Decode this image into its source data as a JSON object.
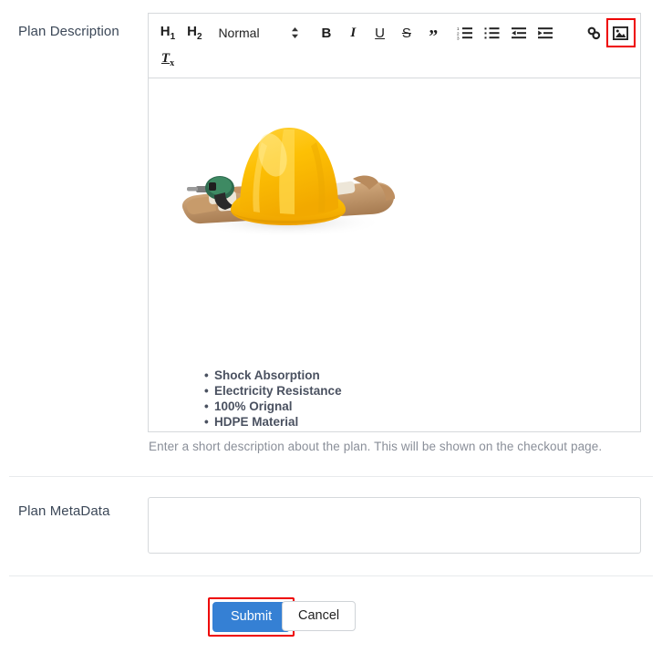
{
  "form": {
    "description_field": {
      "label": "Plan Description",
      "help_text": "Enter a short description about the plan. This will be shown on the checkout page."
    },
    "metadata_field": {
      "label": "Plan MetaData",
      "value": "",
      "placeholder": ""
    }
  },
  "editor": {
    "toolbar": {
      "heading1": "H1",
      "heading1_text": "H",
      "heading1_sub": "1",
      "heading2_text": "H",
      "heading2_sub": "2",
      "format_picker": "Normal",
      "bold": "B",
      "italic": "I",
      "underline": "U",
      "strike": "S",
      "blockquote": "”",
      "clear_format_text": "T",
      "clear_format_sub": "x",
      "items": [
        {
          "name": "header-1",
          "label": "H1"
        },
        {
          "name": "header-2",
          "label": "H2"
        },
        {
          "name": "format-picker",
          "label": "Normal"
        },
        {
          "name": "bold",
          "label": "B"
        },
        {
          "name": "italic",
          "label": "I"
        },
        {
          "name": "underline",
          "label": "U"
        },
        {
          "name": "strikethrough",
          "label": "S"
        },
        {
          "name": "blockquote",
          "label": "”"
        },
        {
          "name": "ordered-list",
          "label": ""
        },
        {
          "name": "bullet-list",
          "label": ""
        },
        {
          "name": "outdent",
          "label": ""
        },
        {
          "name": "indent",
          "label": ""
        },
        {
          "name": "link",
          "label": ""
        },
        {
          "name": "image",
          "label": ""
        },
        {
          "name": "clear-format",
          "label": "Tx"
        }
      ],
      "highlighted_item": "image"
    },
    "content": {
      "image_alt": "yellow hard hat with work gloves, drill and screwdriver",
      "features": [
        "Shock Absorption",
        "Electricity Resistance",
        "100% Orignal",
        "HDPE Material"
      ]
    }
  },
  "actions": {
    "submit": "Submit",
    "cancel": "Cancel"
  },
  "colors": {
    "submit_blue": "#3580d4",
    "highlight_red": "#ee0000",
    "label_text": "#3c4858",
    "help_text": "#8a8f99",
    "feature_text": "#4a5160",
    "border": "#d6d9dc"
  }
}
